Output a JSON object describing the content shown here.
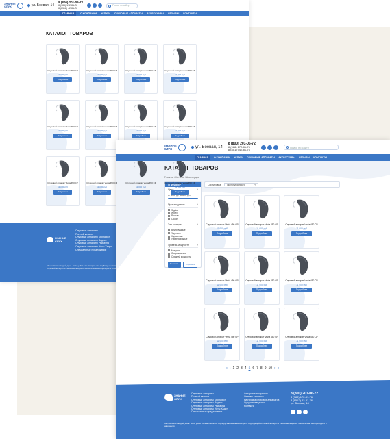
{
  "header": {
    "logo_text": [
      "ЗНАНИЕ",
      "СЛУХ"
    ],
    "address": "ул. Боевая, 14",
    "phone_main": "8 (800) 201-06-72",
    "phone_2": "8 (988) 172-81-76",
    "phone_3": "8 (8512) 42-81-76",
    "search_placeholder": "Поиск по сайту"
  },
  "nav_back": [
    "Главная",
    "О компании",
    "Услуги",
    "Слуховые аппараты",
    "Аксессуары",
    "Отзывы",
    "Контакты"
  ],
  "nav_front": [
    "Главная",
    "О компании",
    "Услуги",
    "Слуховые аппараты",
    "Аксессуары",
    "Отзывы",
    "Контакты"
  ],
  "catalog": {
    "title": "КАТАЛОГ ТОВАРОВ",
    "breadcrumb": "Главная / Каталог / Аксессуары"
  },
  "product": {
    "name": "Слуховой аппарат Vezia 450 CP",
    "price": "11 000 руб",
    "button": "Подробнее"
  },
  "filter": {
    "title": "ФИЛЬТР",
    "price_label": "Цена",
    "price_from": "от",
    "price_from_val": "200",
    "price_to": "до",
    "price_to_val": "12000",
    "price_unit": "руб",
    "brand_label": "Производитель",
    "brands": [
      "Signia",
      "Widex",
      "Phonak",
      "Oticon"
    ],
    "type_label": "Тип корпуса",
    "types": [
      "Внутриушные",
      "Заушные",
      "Карманные",
      "Универсальные"
    ],
    "power_label": "Уровень мощности",
    "powers": [
      "Мощные",
      "Сверхмощные",
      "Средней мощности"
    ],
    "apply": "Показать",
    "reset": "Сбросить"
  },
  "sort": {
    "label": "Сортировка:",
    "value": "По популярности"
  },
  "pager": {
    "pages": [
      "1",
      "2",
      "3",
      "4",
      "5",
      "6",
      "7",
      "8",
      "9",
      "10"
    ],
    "current": "5"
  },
  "footer": {
    "col1": [
      "Слуховые аппараты",
      "Полный каталог",
      "Слуховые аппараты Бернафон",
      "Слуховые аппараты Видекс",
      "Слуховые аппараты Рексаунд",
      "Слуховые аппараты Ноты Хаден",
      "Специальные предложения"
    ],
    "col2": [
      "Аппаратные сервисы",
      "Отзывы клиентов",
      "Настройка слуховых аппаратов",
      "Сурдопереводчики",
      "Контакты"
    ],
    "col2_back_only": false,
    "note": "Мы на связи каждый день. Если у Вас есть вопросы по подбору, мы поможем выбрать подходящий слуховой аппарат и сэкономить время. Звоните нам или приходите в наш центр."
  },
  "colors": {
    "accent": "#3b77c6",
    "accent_dark": "#2c5fad",
    "beige": "#f4f1ea"
  }
}
